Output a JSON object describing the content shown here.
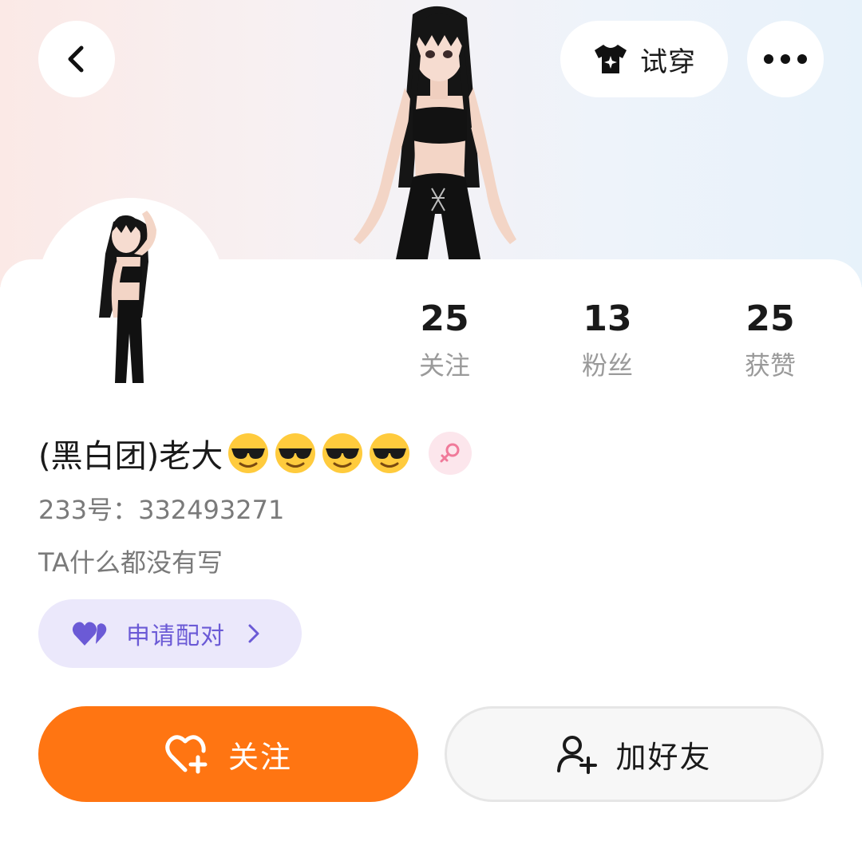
{
  "header": {
    "back_icon": "chevron-left-icon",
    "tryon": {
      "icon": "tshirt-sparkle-icon",
      "label": "试穿"
    },
    "more_icon": "more-dots-icon"
  },
  "profile": {
    "nickname": "(黑白团)老大",
    "emojis": [
      "😎",
      "😎",
      "😎",
      "😎"
    ],
    "gender_icon": "female-icon",
    "user_id": "233号：332493271",
    "bio": "TA什么都没有写"
  },
  "stats": [
    {
      "value": "25",
      "label": "关注"
    },
    {
      "value": "13",
      "label": "粉丝"
    },
    {
      "value": "25",
      "label": "获赞"
    }
  ],
  "match": {
    "icon": "double-heart-icon",
    "label": "申请配对",
    "chevron_icon": "chevron-right-icon"
  },
  "actions": {
    "follow": {
      "icon": "heart-plus-icon",
      "label": "关注"
    },
    "add_friend": {
      "icon": "user-plus-icon",
      "label": "加好友"
    }
  },
  "colors": {
    "accent_orange": "#ff7512",
    "match_purple": "#6b5ad6",
    "match_bg": "#ebe8fb",
    "gender_pink": "#f07a9a"
  }
}
